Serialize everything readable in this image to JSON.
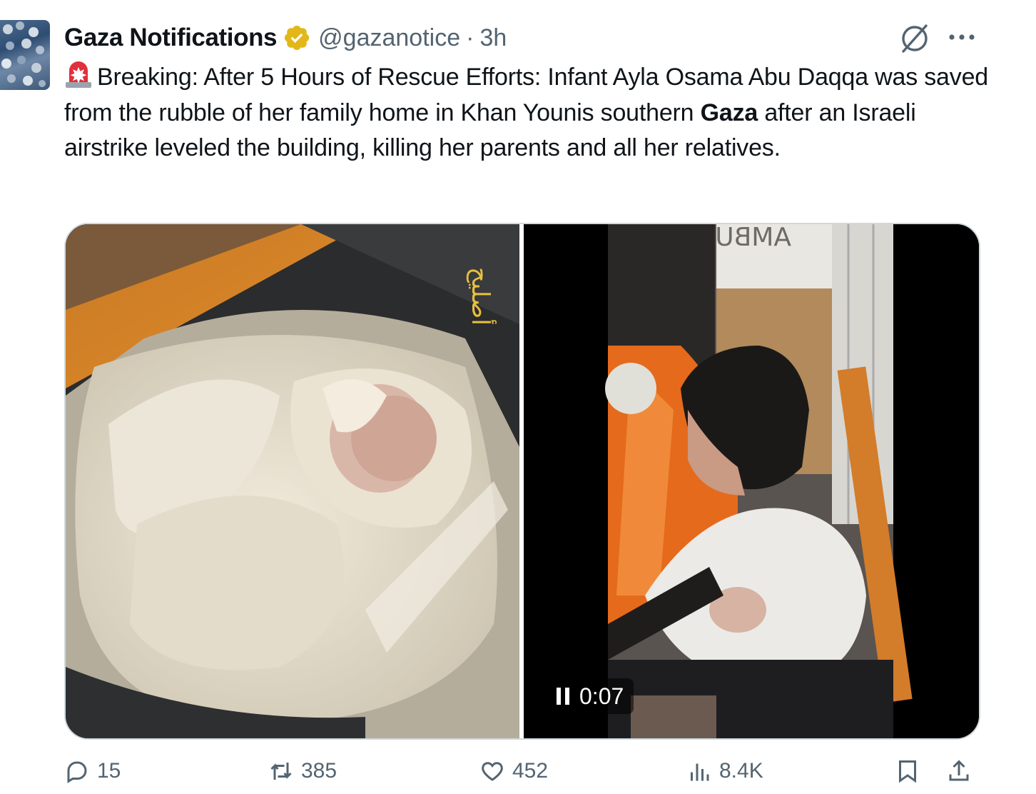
{
  "tweet": {
    "author_name": "Gaza Notifications",
    "handle": "@gazanotice",
    "separator": "·",
    "time": "3h",
    "text_part1": "Breaking: After 5 Hours of Rescue Efforts: Infant Ayla Osama Abu Daqqa was saved from the rubble of her family home in Khan Younis southern ",
    "text_bold": "Gaza",
    "text_part2": " after an Israeli airstrike leveled the building, killing her parents and all her relatives."
  },
  "media": {
    "left_overlay_text": "أصليح",
    "video_sign_text": "AMBU",
    "video_time": "0:07"
  },
  "actions": {
    "replies": "15",
    "reposts": "385",
    "likes": "452",
    "views": "8.4K"
  },
  "icons": [
    "avatar",
    "verified-badge-icon",
    "grok-icon",
    "more-icon",
    "siren-emoji-icon",
    "pause-icon",
    "reply-icon",
    "repost-icon",
    "like-icon",
    "views-icon",
    "bookmark-icon",
    "share-icon"
  ],
  "colors": {
    "verified_gold": "#e2b719",
    "secondary_text": "#536471",
    "border": "#cfd9de"
  }
}
